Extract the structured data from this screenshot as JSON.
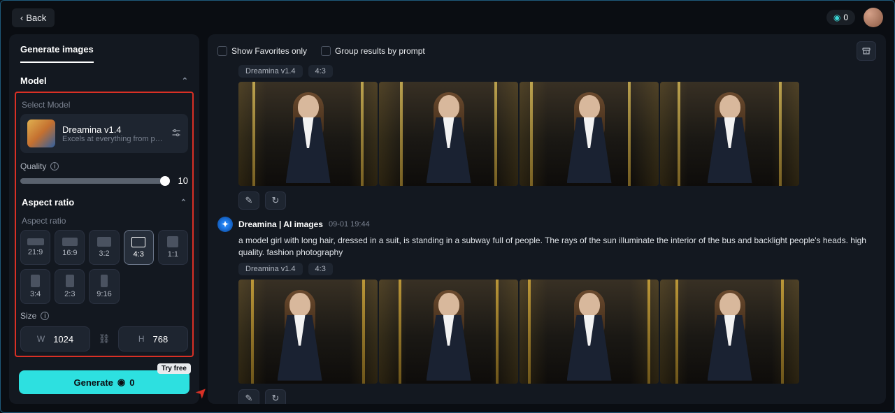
{
  "topbar": {
    "back": "Back",
    "credits": "0"
  },
  "sidebar": {
    "tab": "Generate images",
    "model_head": "Model",
    "select_model": "Select Model",
    "model_name": "Dreamina v1.4",
    "model_desc": "Excels at everything from photoreali...",
    "quality_label": "Quality",
    "quality_value": "10",
    "aspect_head": "Aspect ratio",
    "aspect_label": "Aspect ratio",
    "ratios": [
      "21:9",
      "16:9",
      "3:2",
      "4:3",
      "1:1",
      "3:4",
      "2:3",
      "9:16"
    ],
    "selected_ratio": "4:3",
    "size_label": "Size",
    "w_label": "W",
    "w_value": "1024",
    "h_label": "H",
    "h_value": "768",
    "generate": "Generate",
    "gen_cost": "0",
    "try_free": "Try free"
  },
  "content": {
    "show_fav": "Show Favorites only",
    "group_prompt": "Group results by prompt",
    "tag_model": "Dreamina v1.4",
    "tag_ratio": "4:3",
    "meta_title": "Dreamina | AI images",
    "meta_time": "09-01  19:44",
    "prompt": "a model girl with long hair, dressed in a suit, is standing in a subway full of people. The rays of the sun illuminate the interior of the bus and backlight people's heads. high quality. fashion photography"
  }
}
